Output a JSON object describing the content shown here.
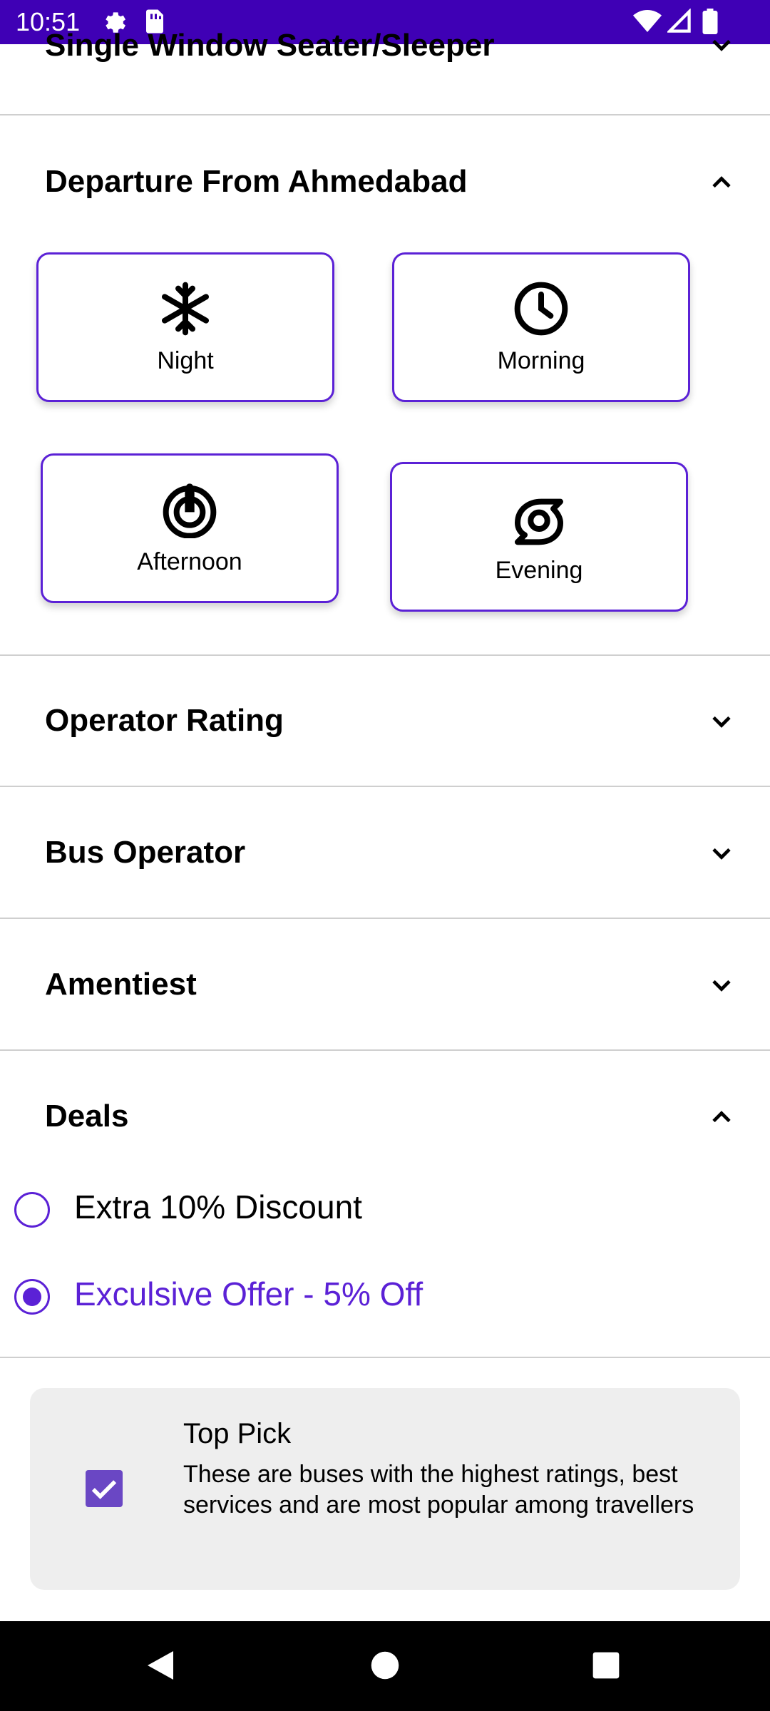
{
  "status_bar": {
    "time": "10:51",
    "bg_color": "#3f00b5",
    "icons": [
      "settings-icon",
      "sim-card-icon",
      "wifi-icon",
      "signal-icon",
      "battery-icon"
    ]
  },
  "sections": {
    "seat_type": {
      "title": "Single Window Seater/Sleeper",
      "expanded": false
    },
    "departure": {
      "title": "Departure From Ahmedabad",
      "expanded": true,
      "options": [
        {
          "label": "Night",
          "icon": "snowflake-icon"
        },
        {
          "label": "Morning",
          "icon": "clock-icon"
        },
        {
          "label": "Afternoon",
          "icon": "target-icon"
        },
        {
          "label": "Evening",
          "icon": "spiral-icon"
        }
      ]
    },
    "operator_rating": {
      "title": "Operator Rating",
      "expanded": false
    },
    "bus_operator": {
      "title": "Bus Operator",
      "expanded": false
    },
    "amenities": {
      "title": "Amentiest",
      "expanded": false
    },
    "deals": {
      "title": "Deals",
      "expanded": true,
      "options": [
        {
          "label": "Extra 10% Discount",
          "selected": false
        },
        {
          "label": "Exculsive Offer - 5% Off",
          "selected": true
        }
      ]
    }
  },
  "top_pick": {
    "title": "Top Pick",
    "description": "These are buses with the highest ratings, best services and are most popular among travellers",
    "checked": true
  },
  "colors": {
    "accent": "#5b21d6",
    "checkbox": "#6a47c4",
    "divider": "#cfcfcf",
    "toppick_bg": "#eeeeee"
  }
}
